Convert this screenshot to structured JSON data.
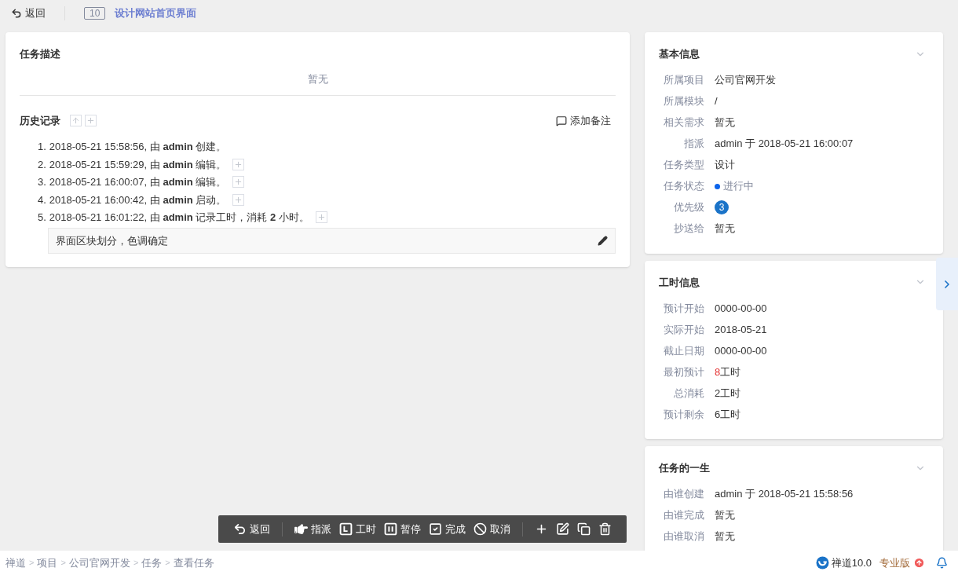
{
  "header": {
    "back_label": "返回",
    "task_id": "10",
    "task_title": "设计网站首页界面"
  },
  "description": {
    "title": "任务描述",
    "content": "暂无"
  },
  "history": {
    "title": "历史记录",
    "add_note_label": "添加备注",
    "entries": [
      {
        "number": "1.",
        "text": "2018-05-21 15:58:56, 由 **admin** 创建。",
        "expandable": false
      },
      {
        "number": "2.",
        "text": "2018-05-21 15:59:29, 由 **admin** 编辑。",
        "expandable": true
      },
      {
        "number": "3.",
        "text": "2018-05-21 16:00:07, 由 **admin** 编辑。",
        "expandable": true
      },
      {
        "number": "4.",
        "text": "2018-05-21 16:00:42, 由 **admin** 启动。",
        "expandable": true
      },
      {
        "number": "5.",
        "text": "2018-05-21 16:01:22, 由 **admin** 记录工时，消耗 **2** 小时。",
        "expandable": true,
        "comment": "界面区块划分，色调确定"
      }
    ]
  },
  "cards": [
    {
      "title": "基本信息",
      "rows": [
        {
          "kind": "text",
          "label": "所属项目",
          "value": "公司官网开发"
        },
        {
          "kind": "text",
          "label": "所属模块",
          "value": "/"
        },
        {
          "kind": "text",
          "label": "相关需求",
          "value": "暂无"
        },
        {
          "kind": "text",
          "label": "指派",
          "value": "admin 于 2018-05-21 16:00:07"
        },
        {
          "kind": "text",
          "label": "任务类型",
          "value": "设计"
        },
        {
          "kind": "status",
          "label": "任务状态",
          "value": "进行中",
          "color": "#0c64eb"
        },
        {
          "kind": "priority",
          "label": "优先级",
          "value": "3"
        },
        {
          "kind": "text",
          "label": "抄送给",
          "value": "暂无"
        }
      ]
    },
    {
      "title": "工时信息",
      "rows": [
        {
          "kind": "text",
          "label": "预计开始",
          "value": "0000-00-00"
        },
        {
          "kind": "text",
          "label": "实际开始",
          "value": "2018-05-21"
        },
        {
          "kind": "text",
          "label": "截止日期",
          "value": "0000-00-00"
        },
        {
          "kind": "hours",
          "label": "最初预计",
          "number": "8",
          "unit": "工时",
          "highlight": true
        },
        {
          "kind": "hours",
          "label": "总消耗",
          "number": "2",
          "unit": "工时",
          "highlight": false
        },
        {
          "kind": "hours",
          "label": "预计剩余",
          "number": "6",
          "unit": "工时",
          "highlight": false
        }
      ]
    },
    {
      "title": "任务的一生",
      "rows": [
        {
          "kind": "text",
          "label": "由谁创建",
          "value": "admin 于 2018-05-21 15:58:56"
        },
        {
          "kind": "text",
          "label": "由谁完成",
          "value": "暂无"
        },
        {
          "kind": "text",
          "label": "由谁取消",
          "value": "暂无"
        }
      ]
    }
  ],
  "toolbar": [
    {
      "kind": "back",
      "label": "返回"
    },
    {
      "kind": "divider"
    },
    {
      "kind": "assign",
      "label": "指派"
    },
    {
      "kind": "effort",
      "label": "工时"
    },
    {
      "kind": "pause",
      "label": "暂停"
    },
    {
      "kind": "finish",
      "label": "完成"
    },
    {
      "kind": "cancel",
      "label": "取消"
    },
    {
      "kind": "divider"
    },
    {
      "kind": "add"
    },
    {
      "kind": "edit"
    },
    {
      "kind": "copy"
    },
    {
      "kind": "delete"
    }
  ],
  "footer": {
    "breadcrumb": [
      {
        "kind": "link",
        "text": "禅道"
      },
      {
        "kind": "separator",
        "text": ">"
      },
      {
        "kind": "link",
        "text": "项目"
      },
      {
        "kind": "separator",
        "text": ">"
      },
      {
        "kind": "link",
        "text": "公司官网开发"
      },
      {
        "kind": "separator",
        "text": ">"
      },
      {
        "kind": "link",
        "text": "任务"
      },
      {
        "kind": "separator",
        "text": ">"
      },
      {
        "kind": "link",
        "text": "查看任务"
      }
    ],
    "version": "禅道10.0",
    "edition": "专业版"
  }
}
